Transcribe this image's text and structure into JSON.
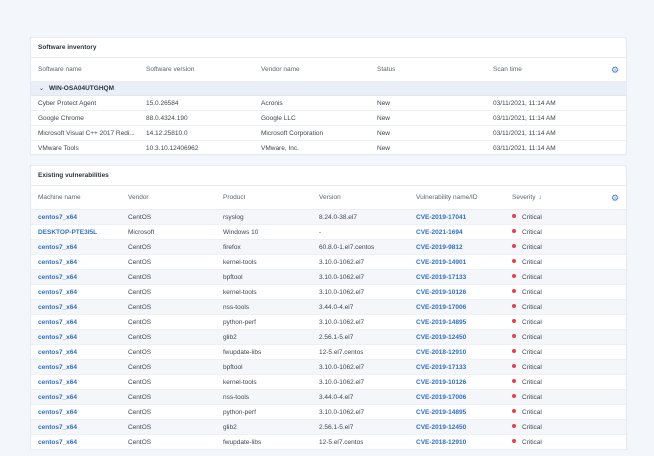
{
  "colors": {
    "accent": "#2f6fc9",
    "critical": "#e0454f",
    "group_bg": "#e9eef7"
  },
  "inventory": {
    "title": "Software inventory",
    "columns": [
      "Software name",
      "Software version",
      "Vendor name",
      "Status",
      "Scan time"
    ],
    "settings_icon": "gear-icon",
    "group": {
      "label": "WIN-OSA04UTGHQM",
      "icon": "chevron-down-icon"
    },
    "rows": [
      [
        "Cyber Protect Agent",
        "15.0.26584",
        "Acronis",
        "New",
        "03/11/2021, 11:14 AM"
      ],
      [
        "Google Chrome",
        "88.0.4324.190",
        "Google LLC",
        "New",
        "03/11/2021, 11:14 AM"
      ],
      [
        "Microsoft Visual C++ 2017 Redi...",
        "14.12.25810.0",
        "Microsoft Corporation",
        "New",
        "03/11/2021, 11:14 AM"
      ],
      [
        "VMware Tools",
        "10.3.10.12406962",
        "VMware, Inc.",
        "New",
        "03/11/2021, 11:14 AM"
      ]
    ]
  },
  "vulnerabilities": {
    "title": "Existing vulnerabilities",
    "columns": [
      "Machine name",
      "Vendor",
      "Product",
      "Version",
      "Vulnerability name/ID",
      "Severity"
    ],
    "sort_icon": "arrow-down-icon",
    "settings_icon": "gear-icon",
    "rows": [
      [
        "centos7_x64",
        "CentOS",
        "rsyslog",
        "8.24.0-38.el7",
        "CVE-2019-17041",
        "Critical"
      ],
      [
        "DESKTOP-PTE3I5L",
        "Microsoft",
        "Windows 10",
        "-",
        "CVE-2021-1694",
        "Critical"
      ],
      [
        "centos7_x64",
        "CentOS",
        "firefox",
        "60.8.0-1.el7.centos",
        "CVE-2019-9812",
        "Critical"
      ],
      [
        "centos7_x64",
        "CentOS",
        "kernel-tools",
        "3.10.0-1062.el7",
        "CVE-2019-14901",
        "Critical"
      ],
      [
        "centos7_x64",
        "CentOS",
        "bpftool",
        "3.10.0-1062.el7",
        "CVE-2019-17133",
        "Critical"
      ],
      [
        "centos7_x64",
        "CentOS",
        "kernel-tools",
        "3.10.0-1062.el7",
        "CVE-2019-10126",
        "Critical"
      ],
      [
        "centos7_x64",
        "CentOS",
        "nss-tools",
        "3.44.0-4.el7",
        "CVE-2019-17006",
        "Critical"
      ],
      [
        "centos7_x64",
        "CentOS",
        "python-perf",
        "3.10.0-1062.el7",
        "CVE-2019-14895",
        "Critical"
      ],
      [
        "centos7_x64",
        "CentOS",
        "glib2",
        "2.56.1-5.el7",
        "CVE-2019-12450",
        "Critical"
      ],
      [
        "centos7_x64",
        "CentOS",
        "fwupdate-libs",
        "12-5.el7.centos",
        "CVE-2018-12910",
        "Critical"
      ],
      [
        "centos7_x64",
        "CentOS",
        "bpftool",
        "3.10.0-1062.el7",
        "CVE-2019-17133",
        "Critical"
      ],
      [
        "centos7_x64",
        "CentOS",
        "kernel-tools",
        "3.10.0-1062.el7",
        "CVE-2019-10126",
        "Critical"
      ],
      [
        "centos7_x64",
        "CentOS",
        "nss-tools",
        "3.44.0-4.el7",
        "CVE-2019-17006",
        "Critical"
      ],
      [
        "centos7_x64",
        "CentOS",
        "python-perf",
        "3.10.0-1062.el7",
        "CVE-2019-14895",
        "Critical"
      ],
      [
        "centos7_x64",
        "CentOS",
        "glib2",
        "2.56.1-5.el7",
        "CVE-2019-12450",
        "Critical"
      ],
      [
        "centos7_x64",
        "CentOS",
        "fwupdate-libs",
        "12-5.el7.centos",
        "CVE-2018-12910",
        "Critical"
      ]
    ]
  }
}
